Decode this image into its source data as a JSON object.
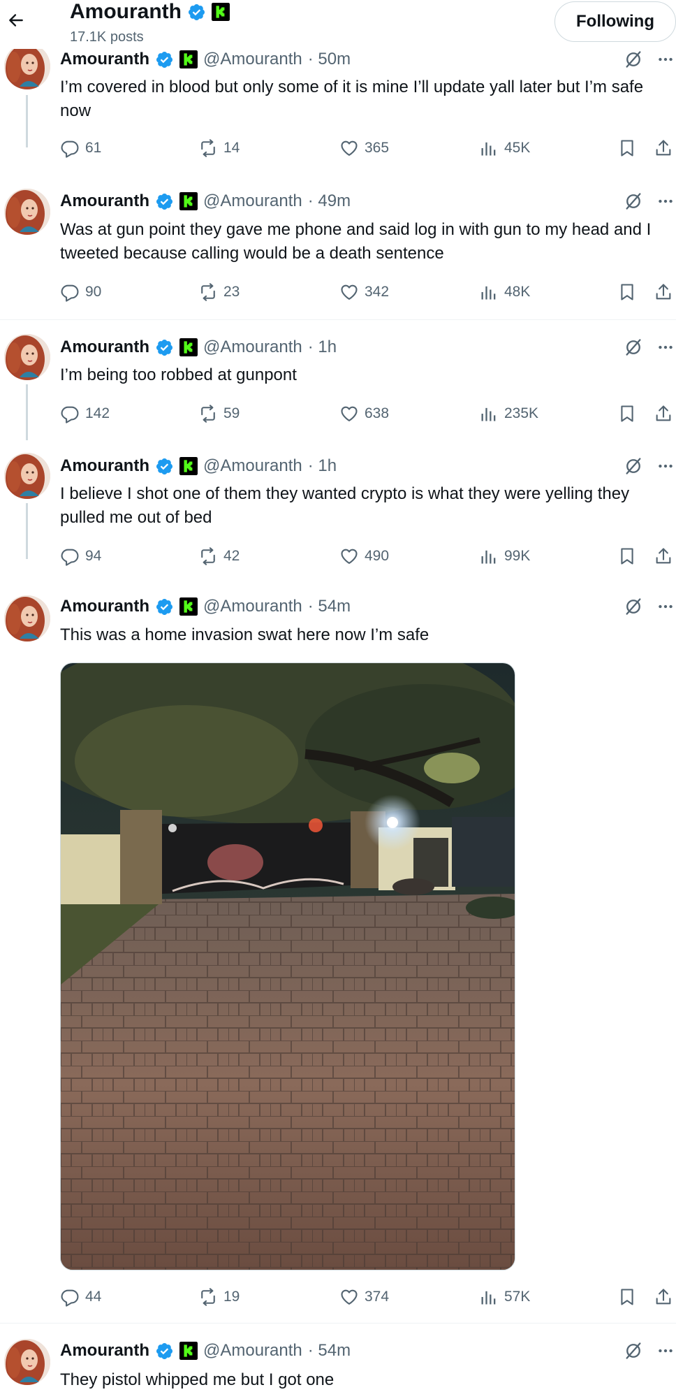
{
  "header": {
    "name": "Amouranth",
    "post_count": "17.1K posts",
    "follow_label": "Following"
  },
  "tweets": [
    {
      "name": "Amouranth",
      "handle": "@Amouranth",
      "time": "· 50m",
      "text": "I’m covered in blood but only some of it is mine I’ll update yall later but I’m safe now",
      "replies": "61",
      "retweets": "14",
      "likes": "365",
      "views": "45K"
    },
    {
      "name": "Amouranth",
      "handle": "@Amouranth",
      "time": "· 49m",
      "text": "Was at gun point they gave me phone and said log in with gun to my head and I tweeted because calling would be a death sentence",
      "replies": "90",
      "retweets": "23",
      "likes": "342",
      "views": "48K"
    },
    {
      "name": "Amouranth",
      "handle": "@Amouranth",
      "time": "· 1h",
      "text": "I’m being too robbed at gunpont",
      "replies": "142",
      "retweets": "59",
      "likes": "638",
      "views": "235K"
    },
    {
      "name": "Amouranth",
      "handle": "@Amouranth",
      "time": "· 1h",
      "text": "I believe I shot one of them they wanted crypto is what they were yelling they pulled me out of bed",
      "replies": "94",
      "retweets": "42",
      "likes": "490",
      "views": "99K"
    },
    {
      "name": "Amouranth",
      "handle": "@Amouranth",
      "time": "· 54m",
      "text": "This was a home invasion swat here now I’m safe",
      "replies": "44",
      "retweets": "19",
      "likes": "374",
      "views": "57K"
    },
    {
      "name": "Amouranth",
      "handle": "@Amouranth",
      "time": "· 54m",
      "text": "They pistol whipped me but I got one"
    }
  ],
  "colors": {
    "text": "#0f1419",
    "secondary": "#536471",
    "verified_blue": "#1d9bf0",
    "kick_green": "#53fc18",
    "border": "#cfd9de"
  },
  "icons": {
    "back": "arrow-left-icon",
    "verified": "verified-badge-icon",
    "kick": "kick-logo-icon",
    "grok": "grok-icon",
    "more": "more-icon",
    "reply": "reply-icon",
    "retweet": "retweet-icon",
    "like": "heart-icon",
    "views": "views-icon",
    "bookmark": "bookmark-icon",
    "share": "share-icon"
  }
}
